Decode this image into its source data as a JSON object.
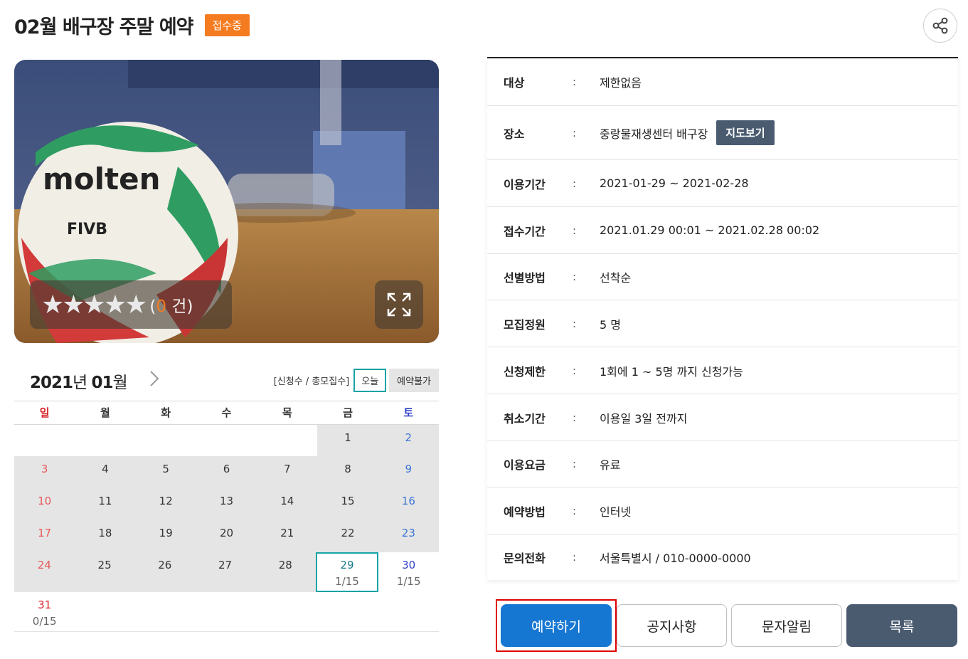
{
  "header": {
    "title": "02월 배구장 주말 예약",
    "status": "접수중"
  },
  "photo": {
    "stars": "★★★★★",
    "rating_open": "(",
    "rating_count": "0",
    "rating_close": " 건)"
  },
  "calendar": {
    "year": "2021",
    "year_suffix": "년",
    "month": "01",
    "month_suffix": "월",
    "legend_count": "[신청수 / 총모집수]",
    "legend_today": "오늘",
    "legend_unavailable": "예약불가",
    "weekdays": [
      "일",
      "월",
      "화",
      "수",
      "목",
      "금",
      "토"
    ],
    "days": {
      "d1": "1",
      "d2": "2",
      "d3": "3",
      "d4": "4",
      "d5": "5",
      "d6": "6",
      "d7": "7",
      "d8": "8",
      "d9": "9",
      "d10": "10",
      "d11": "11",
      "d12": "12",
      "d13": "13",
      "d14": "14",
      "d15": "15",
      "d16": "16",
      "d17": "17",
      "d18": "18",
      "d19": "19",
      "d20": "20",
      "d21": "21",
      "d22": "22",
      "d23": "23",
      "d24": "24",
      "d25": "25",
      "d26": "26",
      "d27": "27",
      "d28": "28",
      "d29": "29",
      "d30": "30",
      "d31": "31"
    },
    "counts": {
      "d29": "1/15",
      "d30": "1/15",
      "d31": "0/15"
    }
  },
  "info": {
    "colon": ":",
    "rows": [
      {
        "label": "대상",
        "value": "제한없음"
      },
      {
        "label": "장소",
        "value": "중랑물재생센터 배구장"
      },
      {
        "label": "이용기간",
        "value": "2021-01-29 ~ 2021-02-28"
      },
      {
        "label": "접수기간",
        "value": "2021.01.29 00:01 ~ 2021.02.28 00:02"
      },
      {
        "label": "선별방법",
        "value": "선착순"
      },
      {
        "label": "모집정원",
        "value": "5 명"
      },
      {
        "label": "신청제한",
        "value": "1회에 1 ~ 5명 까지 신청가능"
      },
      {
        "label": "취소기간",
        "value": "이용일 3일 전까지"
      },
      {
        "label": "이용요금",
        "value": "유료"
      },
      {
        "label": "예약방법",
        "value": "인터넷"
      },
      {
        "label": "문의전화",
        "value": "서울특별시 / 010-0000-0000"
      }
    ],
    "map_button": "지도보기"
  },
  "actions": {
    "reserve": "예약하기",
    "notice": "공지사항",
    "sms": "문자알림",
    "list": "목록"
  },
  "colors": {
    "status_badge": "#f47b20",
    "reserve_button": "#1677d2",
    "dark_button": "#4a5b70",
    "today_border": "#1aa3a3",
    "sunday": "#d9242a",
    "saturday": "#2f3fc9"
  }
}
